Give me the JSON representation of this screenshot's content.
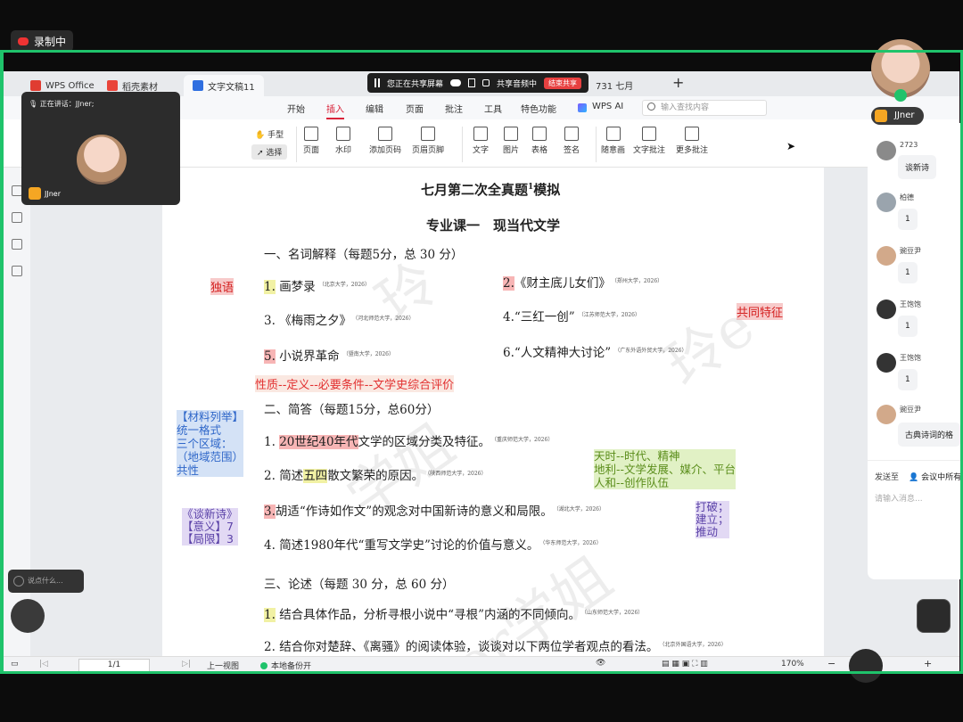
{
  "recording": {
    "label": "录制中"
  },
  "tabs": [
    {
      "label": "WPS Office",
      "color": "#e03c31"
    },
    {
      "label": "稻壳素材",
      "color": "#e9453a"
    },
    {
      "label": "文字文稿11",
      "color": "#2f6fe0"
    }
  ],
  "share_bar": {
    "sharing": "您正在共享屏幕",
    "audio": "共享音频中",
    "stop": "结束共享",
    "tab_partial": "731 七月"
  },
  "menu": [
    "开始",
    "插入",
    "编辑",
    "页面",
    "批注",
    "工具",
    "特色功能",
    "WPS AI"
  ],
  "menu_active": "插入",
  "search": {
    "placeholder": "输入查找内容"
  },
  "toolbar": {
    "hand": "手型",
    "select": "选择",
    "items": [
      "页面",
      "水印",
      "添加页码",
      "页眉页脚",
      "文字",
      "图片",
      "表格",
      "签名",
      "随意画",
      "文字批注",
      "更多批注"
    ]
  },
  "speaker": {
    "speaking": "正在讲话：JJner;",
    "name": "JJner"
  },
  "doc": {
    "title": "七月第二次全真题",
    "title_sup": "1",
    "title_tail": "模拟",
    "subtitle": "专业课一　现当代文学",
    "sec1": "一、名词解释（每题5分，总 30 分）",
    "q1": [
      {
        "num": "1.",
        "text": "画梦录",
        "src": "（北京大学，2026）"
      },
      {
        "num": "2.",
        "text": "《财主底儿女们》",
        "src": "（郑州大学，2026）"
      },
      {
        "num": "3.",
        "text": "《梅雨之夕》",
        "src": "（河北师范大学，2026）"
      },
      {
        "num": "4.",
        "text": "“三红一创”",
        "src": "（江苏师范大学，2026）"
      },
      {
        "num": "5.",
        "text": "小说界革命",
        "src": "（暨南大学，2026）"
      },
      {
        "num": "6.",
        "text": "“人文精神大讨论”",
        "src": "（广东外语外贸大学，2026）"
      }
    ],
    "sec2": "二、简答（每题15分，总60分）",
    "q2": [
      {
        "num": "1.",
        "hl": "20世纪40年代",
        "text": "文学的区域分类及特征。",
        "src": "（重庆师范大学，2026）"
      },
      {
        "num": "2.",
        "pre": "简述",
        "hl": "五四",
        "text": "散文繁荣的原因。",
        "src": "（陕西师范大学，2026）"
      },
      {
        "num": "3.",
        "text": "胡适“作诗如作文”的观念对中国新诗的意义和局限。",
        "src": "（湖北大学，2026）"
      },
      {
        "num": "4.",
        "text": "简述1980年代“重写文学史”讨论的价值与意义。",
        "src": "（华东师范大学，2026）"
      }
    ],
    "sec3": "三、论述（每题 30 分，总 60 分）",
    "q3": [
      {
        "num": "1.",
        "text": "结合具体作品，分析寻根小说中“寻根”内涵的不同倾向。",
        "src": "（山东师范大学，2026）"
      },
      {
        "num": "2.",
        "text": "结合你对楚辞、《离骚》的阅读体验，谈谈对以下两位学者观点的看法。",
        "src": "（北京外国语大学，2026）"
      }
    ],
    "watermark": [
      "玲",
      "学姐",
      "玲e",
      "eer学姐"
    ]
  },
  "annotations": {
    "duyu": "独语",
    "gongtong": "共同特征",
    "xingzhi": "性质--定义--必要条件--文学史综合评价",
    "blue": [
      "【材料列举】",
      "统一格式",
      "三个区域：",
      "（地域范围）",
      "共性"
    ],
    "green": [
      "天时--时代、精神",
      "地利--文学发展、媒介、平台",
      "人和--创作队伍"
    ],
    "purple_left": [
      "《谈新诗》",
      "【意义】7",
      "【局限】3"
    ],
    "purple_right": [
      "打破；",
      "建立；",
      "推动"
    ]
  },
  "statusbar": {
    "page": "1/1",
    "prev_view": "上一视图",
    "backup": "本地备份开",
    "zoom": "170%"
  },
  "chat": {
    "host_tag": "JJner",
    "messages": [
      {
        "user": "2723",
        "text": "谈新诗"
      },
      {
        "user": "柏德",
        "text": "1"
      },
      {
        "user": "豌豆尹",
        "text": "1"
      },
      {
        "user": "王饱饱",
        "text": "1"
      },
      {
        "user": "王饱饱",
        "text": "1"
      },
      {
        "user": "豌豆尹",
        "text": "古典诗词的格"
      }
    ],
    "send_to_label": "发送至",
    "send_to": "会议中所有",
    "input_placeholder": "请输入消息...",
    "float_placeholder": "说点什么..."
  },
  "colors": {
    "share_green": "#1fc36b",
    "accent_red": "#d9233a"
  }
}
